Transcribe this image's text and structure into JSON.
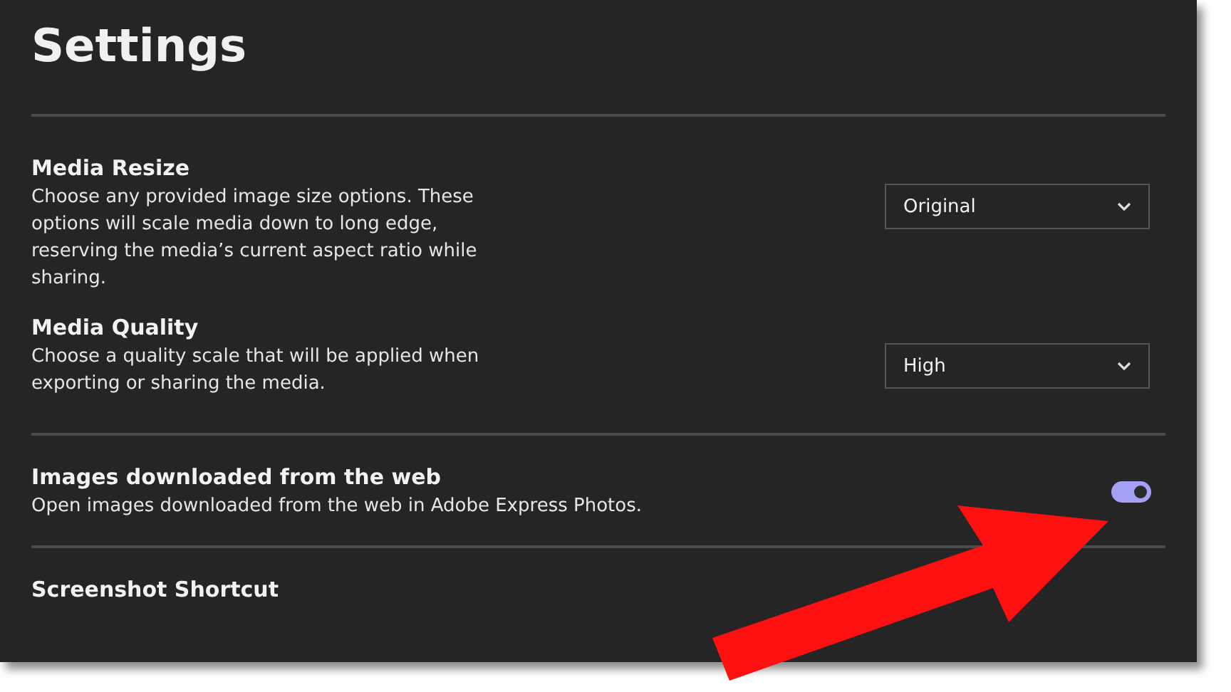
{
  "title": "Settings",
  "sections": [
    {
      "items": [
        {
          "kind": "select",
          "label": "Media Resize",
          "description": "Choose any provided image size options. These options will scale media down to long edge, reserving the media’s current aspect ratio while sharing.",
          "value": "Original"
        },
        {
          "kind": "select",
          "label": "Media Quality",
          "description": "Choose a quality scale that will be applied when exporting or sharing the media.",
          "value": "High"
        }
      ]
    },
    {
      "items": [
        {
          "kind": "toggle",
          "label": "Images downloaded from the web",
          "description": "Open images downloaded from the web in Adobe Express Photos.",
          "on": true
        }
      ]
    },
    {
      "items": [
        {
          "kind": "heading",
          "label": "Screenshot Shortcut"
        }
      ]
    }
  ]
}
